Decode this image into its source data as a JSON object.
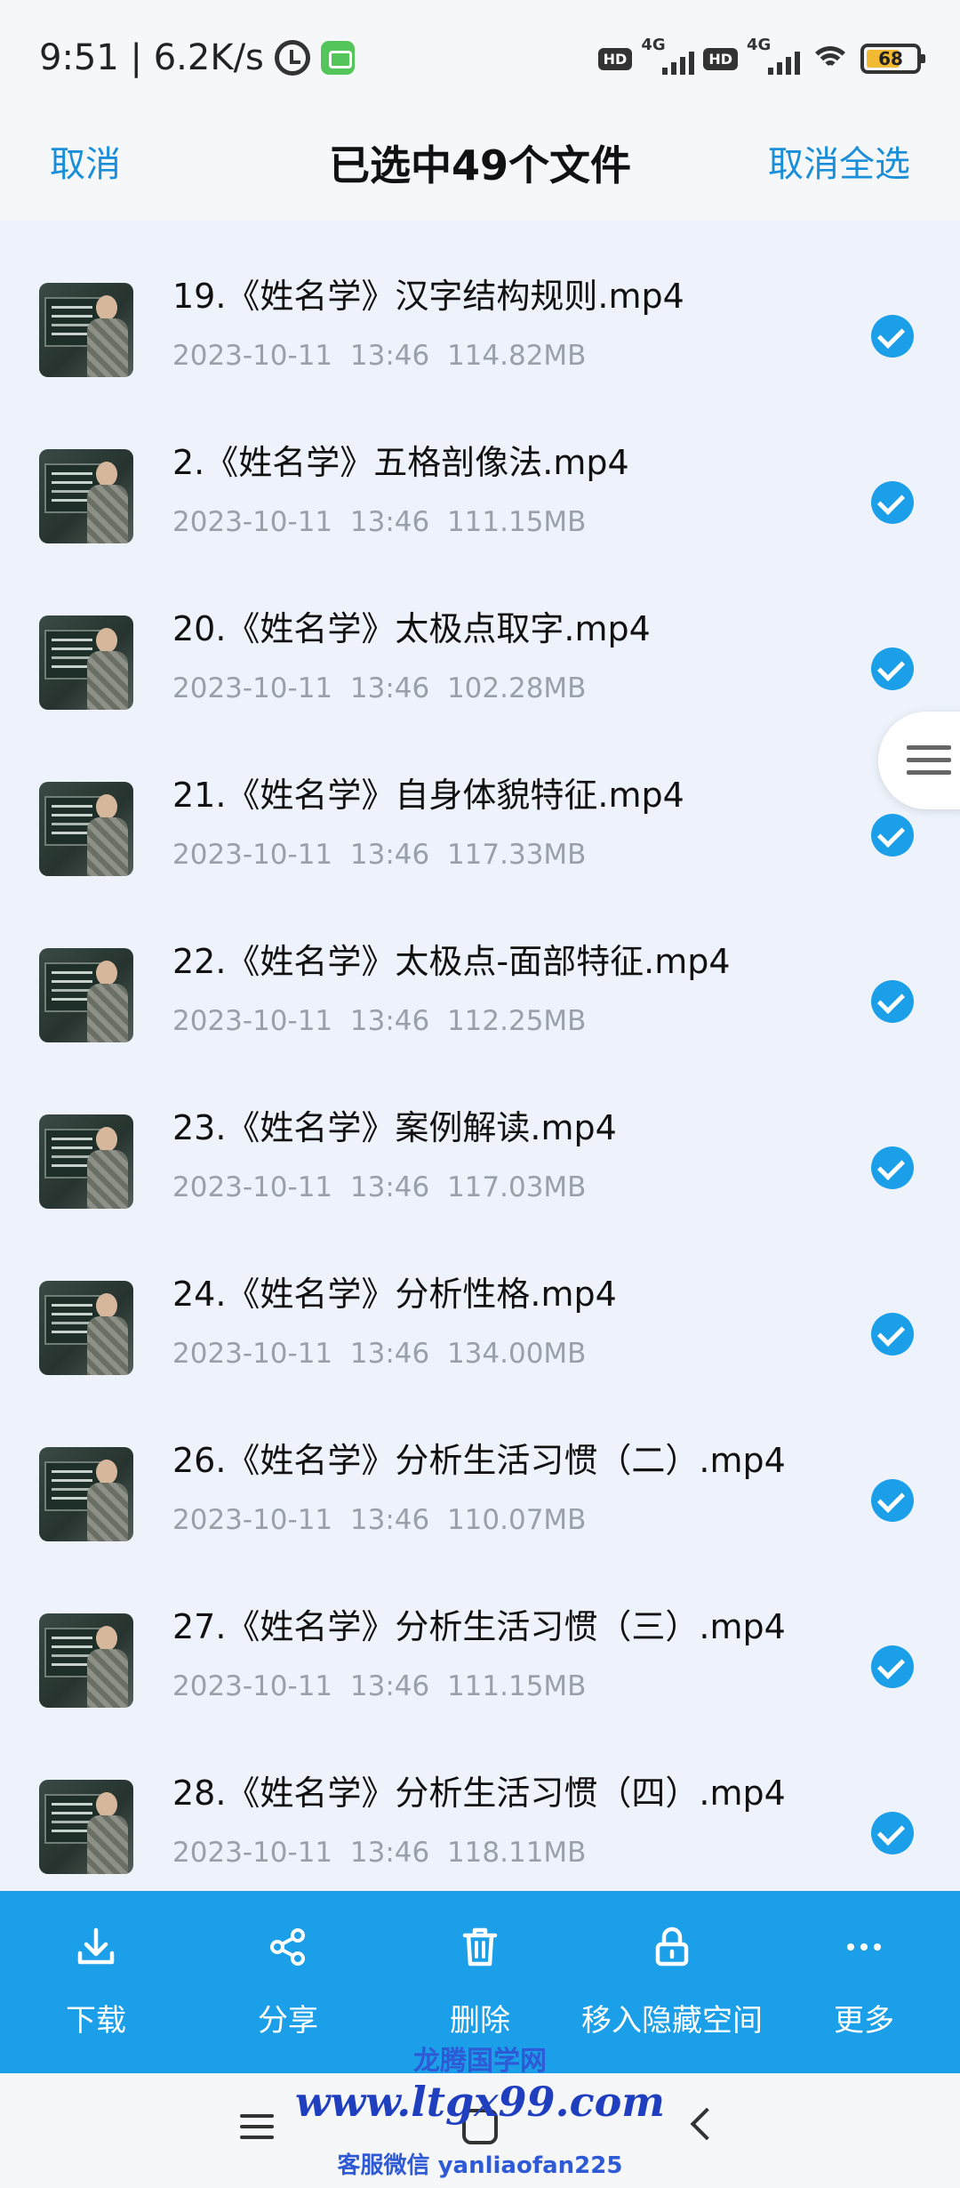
{
  "status_bar": {
    "time_speed": "9:51 | 6.2K/s",
    "hd_label": "HD",
    "network_label": "4G",
    "battery_level": "68",
    "battery_color": "#f2b932"
  },
  "header": {
    "cancel_label": "取消",
    "title": "已选中49个文件",
    "deselect_all_label": "取消全选"
  },
  "files": [
    {
      "name": "19.《姓名学》汉字结构规则.mp4",
      "date": "2023-10-11",
      "time": "13:46",
      "size": "114.82MB"
    },
    {
      "name": "2.《姓名学》五格剖像法.mp4",
      "date": "2023-10-11",
      "time": "13:46",
      "size": "111.15MB"
    },
    {
      "name": "20.《姓名学》太极点取字.mp4",
      "date": "2023-10-11",
      "time": "13:46",
      "size": "102.28MB"
    },
    {
      "name": "21.《姓名学》自身体貌特征.mp4",
      "date": "2023-10-11",
      "time": "13:46",
      "size": "117.33MB"
    },
    {
      "name": "22.《姓名学》太极点-面部特征.mp4",
      "date": "2023-10-11",
      "time": "13:46",
      "size": "112.25MB"
    },
    {
      "name": "23.《姓名学》案例解读.mp4",
      "date": "2023-10-11",
      "time": "13:46",
      "size": "117.03MB"
    },
    {
      "name": "24.《姓名学》分析性格.mp4",
      "date": "2023-10-11",
      "time": "13:46",
      "size": "134.00MB"
    },
    {
      "name": "26.《姓名学》分析生活习惯（二）.mp4",
      "date": "2023-10-11",
      "time": "13:46",
      "size": "110.07MB"
    },
    {
      "name": "27.《姓名学》分析生活习惯（三）.mp4",
      "date": "2023-10-11",
      "time": "13:46",
      "size": "111.15MB"
    },
    {
      "name": "28.《姓名学》分析生活习惯（四）.mp4",
      "date": "2023-10-11",
      "time": "13:46",
      "size": "118.11MB"
    }
  ],
  "actions": [
    {
      "label": "下载",
      "icon": "download-icon"
    },
    {
      "label": "分享",
      "icon": "share-icon"
    },
    {
      "label": "删除",
      "icon": "trash-icon"
    },
    {
      "label": "移入隐藏空间",
      "icon": "lock-icon"
    },
    {
      "label": "更多",
      "icon": "more-icon"
    }
  ],
  "watermark": {
    "line1": "龙腾国学网",
    "line2": "www.ltgx99.com",
    "line3": "客服微信 yanliaofan225"
  },
  "colors": {
    "accent": "#1b9fe8",
    "link": "#1a8fd9",
    "background": "#eef3fb"
  }
}
